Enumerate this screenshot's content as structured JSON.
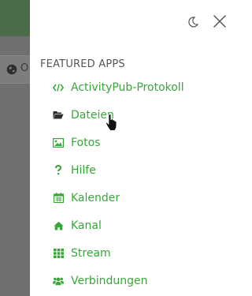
{
  "backdrop": {
    "partial_label": "Ö"
  },
  "panel": {
    "section_title": "FEATURED APPS",
    "accent": "#3aa53a",
    "apps": [
      {
        "label": "ActivityPub-Protokoll",
        "icon": "code-icon"
      },
      {
        "label": "Dateien",
        "icon": "folder-open-icon"
      },
      {
        "label": "Fotos",
        "icon": "image-icon"
      },
      {
        "label": "Hilfe",
        "icon": "question-icon"
      },
      {
        "label": "Kalender",
        "icon": "calendar-icon"
      },
      {
        "label": "Kanal",
        "icon": "home-icon"
      },
      {
        "label": "Stream",
        "icon": "grid-icon"
      },
      {
        "label": "Verbindungen",
        "icon": "users-icon"
      }
    ]
  }
}
